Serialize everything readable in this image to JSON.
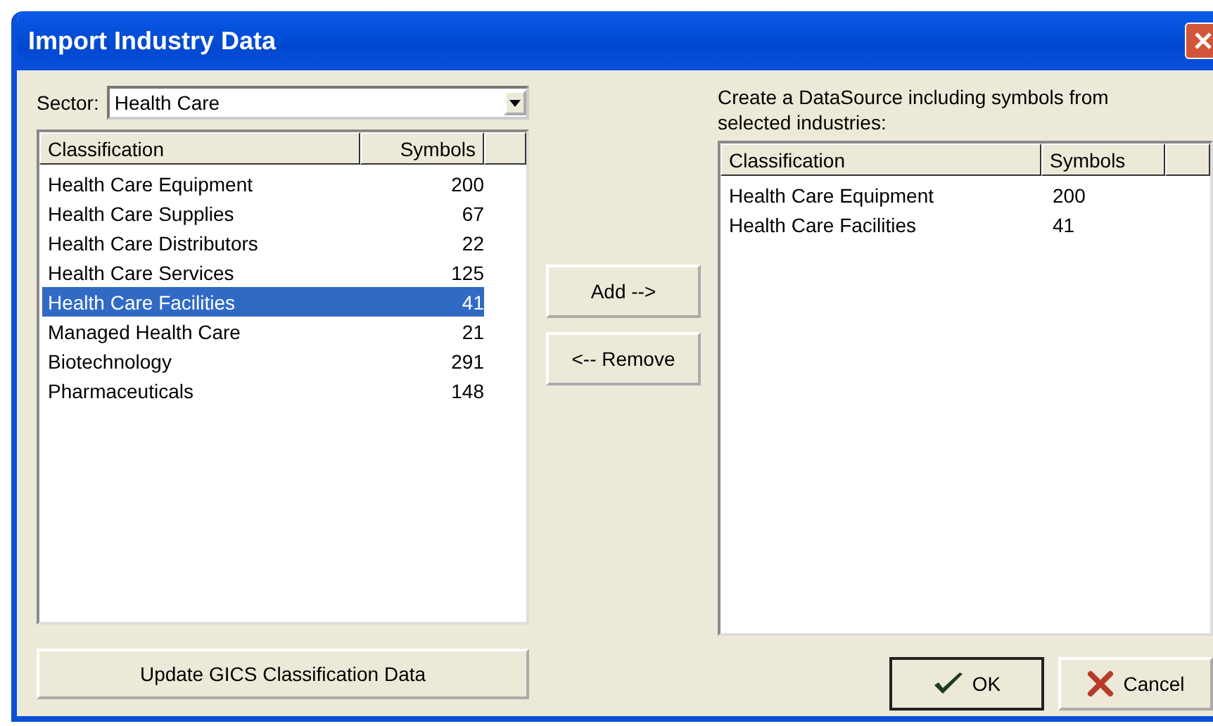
{
  "window": {
    "title": "Import Industry Data"
  },
  "sector": {
    "label": "Sector:",
    "value": "Health Care"
  },
  "available": {
    "columns": [
      "Classification",
      "Symbols"
    ],
    "rows": [
      {
        "classification": "Health Care Equipment",
        "symbols": "200",
        "selected": false
      },
      {
        "classification": "Health Care Supplies",
        "symbols": "67",
        "selected": false
      },
      {
        "classification": "Health Care Distributors",
        "symbols": "22",
        "selected": false
      },
      {
        "classification": "Health Care Services",
        "symbols": "125",
        "selected": false
      },
      {
        "classification": "Health Care Facilities",
        "symbols": "41",
        "selected": true
      },
      {
        "classification": "Managed Health Care",
        "symbols": "21",
        "selected": false
      },
      {
        "classification": "Biotechnology",
        "symbols": "291",
        "selected": false
      },
      {
        "classification": "Pharmaceuticals",
        "symbols": "148",
        "selected": false
      }
    ]
  },
  "add_button": "Add -->",
  "remove_button": "<-- Remove",
  "selected_label": "Create a DataSource including symbols from selected industries:",
  "chosen": {
    "columns": [
      "Classification",
      "Symbols"
    ],
    "rows": [
      {
        "classification": "Health Care Equipment",
        "symbols": "200"
      },
      {
        "classification": "Health Care Facilities",
        "symbols": "41"
      }
    ]
  },
  "update_button": "Update GICS Classification Data",
  "ok_button": "OK",
  "cancel_button": "Cancel"
}
